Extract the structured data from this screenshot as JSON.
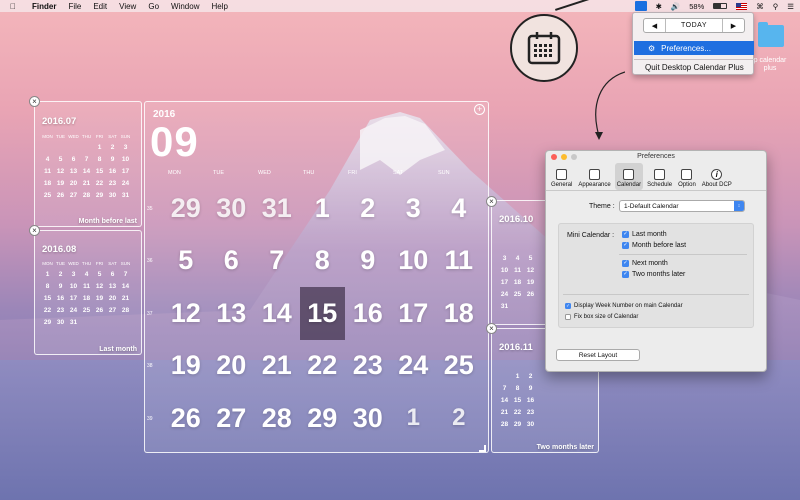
{
  "menubar": {
    "app": "Finder",
    "items": [
      "File",
      "Edit",
      "View",
      "Go",
      "Window",
      "Help"
    ],
    "battery": "58%"
  },
  "dropdown": {
    "today": "TODAY",
    "prev": "◀",
    "next": "▶",
    "preferences": "Preferences...",
    "quit": "Quit Desktop Calendar Plus"
  },
  "desktop_folder": {
    "label_line1": "p calendar",
    "label_line2": "plus"
  },
  "month_before_last": {
    "title": "2016.07",
    "caption": "Month before last",
    "headers": [
      "MON",
      "TUE",
      "WED",
      "THU",
      "FRI",
      "SAT",
      "SUN"
    ],
    "days": [
      "",
      "",
      "",
      "",
      "1",
      "2",
      "3",
      "4",
      "5",
      "6",
      "7",
      "8",
      "9",
      "10",
      "11",
      "12",
      "13",
      "14",
      "15",
      "16",
      "17",
      "18",
      "19",
      "20",
      "21",
      "22",
      "23",
      "24",
      "25",
      "26",
      "27",
      "28",
      "29",
      "30",
      "31"
    ]
  },
  "last_month": {
    "title": "2016.08",
    "caption": "Last month",
    "headers": [
      "MON",
      "TUE",
      "WED",
      "THU",
      "FRI",
      "SAT",
      "SUN"
    ],
    "days": [
      "1",
      "2",
      "3",
      "4",
      "5",
      "6",
      "7",
      "8",
      "9",
      "10",
      "11",
      "12",
      "13",
      "14",
      "15",
      "16",
      "17",
      "18",
      "19",
      "20",
      "21",
      "22",
      "23",
      "24",
      "25",
      "26",
      "27",
      "28",
      "29",
      "30",
      "31"
    ]
  },
  "main": {
    "year": "2016",
    "month": "09",
    "headers": [
      "MON",
      "TUE",
      "WED",
      "THU",
      "FRI",
      "SAT",
      "SUN"
    ],
    "weeks": [
      "35",
      "36",
      "37",
      "38",
      "39"
    ],
    "days": [
      "29",
      "30",
      "31",
      "1",
      "2",
      "3",
      "4",
      "5",
      "6",
      "7",
      "8",
      "9",
      "10",
      "11",
      "12",
      "13",
      "14",
      "15",
      "16",
      "17",
      "18",
      "19",
      "20",
      "21",
      "22",
      "23",
      "24",
      "25",
      "26",
      "27",
      "28",
      "29",
      "30",
      "1",
      "2"
    ],
    "today": "15"
  },
  "next_month": {
    "title": "2016.10",
    "days_visible": [
      "3",
      "4",
      "5",
      "10",
      "11",
      "12",
      "17",
      "18",
      "19",
      "24",
      "25",
      "26",
      "31"
    ]
  },
  "two_months_later": {
    "title": "2016.11",
    "caption": "Two months later",
    "days_visible": [
      "1",
      "2",
      "7",
      "8",
      "9",
      "14",
      "15",
      "16",
      "21",
      "22",
      "23",
      "28",
      "29",
      "30"
    ]
  },
  "preferences": {
    "title": "Preferences",
    "tabs": [
      "General",
      "Appearance",
      "Calendar",
      "Schedule",
      "Option",
      "About DCP"
    ],
    "selected_tab": "Calendar",
    "theme_label": "Theme :",
    "theme_value": "1-Default Calendar",
    "mini_calendar_label": "Mini Calendar :",
    "checks": {
      "last_month": "Last month",
      "month_before_last": "Month before last",
      "next_month": "Next month",
      "two_months_later": "Two months later",
      "week_number": "Display Week Number on main Calendar",
      "fix_box": "Fix box size of Calendar"
    },
    "reset": "Reset Layout"
  },
  "colors": {
    "accent": "#3f86f0",
    "menu_highlight": "#1f6fe0"
  }
}
